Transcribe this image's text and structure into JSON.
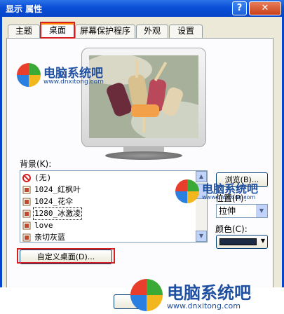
{
  "window": {
    "title": "显示 属性",
    "help_label": "?",
    "close_label": "✕"
  },
  "tabs": [
    {
      "label": "主题",
      "active": false
    },
    {
      "label": "桌面",
      "active": true
    },
    {
      "label": "屏幕保护程序",
      "active": false
    },
    {
      "label": "外观",
      "active": false
    },
    {
      "label": "设置",
      "active": false
    }
  ],
  "preview": {
    "wallpaper": "ice-cream-popsicles"
  },
  "background": {
    "label": "背景(K):",
    "items": [
      {
        "label": "(无)",
        "icon": "none-icon",
        "selected": false
      },
      {
        "label": "1024_红枫叶",
        "icon": "image-file-icon",
        "selected": false
      },
      {
        "label": "1024_花伞",
        "icon": "image-file-icon",
        "selected": false
      },
      {
        "label": "1280_冰激凌",
        "icon": "image-file-icon",
        "selected": true
      },
      {
        "label": "love",
        "icon": "image-file-icon",
        "selected": false
      },
      {
        "label": "亲切灰蓝",
        "icon": "image-file-icon",
        "selected": false
      }
    ],
    "browse_label": "浏览(B)..."
  },
  "position": {
    "label": "位置(P):",
    "value": "拉伸"
  },
  "color": {
    "label": "颜色(C):",
    "value": "#1c2b45"
  },
  "custom_desktop_label": "自定义桌面(D)...",
  "watermark": {
    "title": "电脑系统吧",
    "url": "www.dnxitong.com",
    "colors": [
      "#e83e2b",
      "#3aa935",
      "#2a7fe0",
      "#f2b71c"
    ]
  }
}
